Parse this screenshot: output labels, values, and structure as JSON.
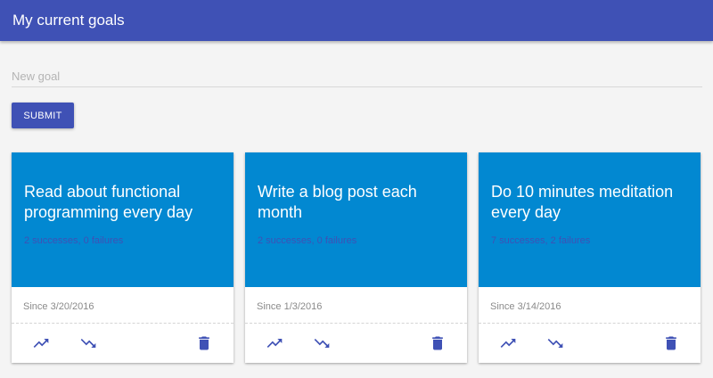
{
  "header": {
    "title": "My current goals"
  },
  "form": {
    "placeholder": "New goal",
    "value": "",
    "submit_label": "SUBMIT"
  },
  "colors": {
    "primary": "#3f51b5",
    "card_media": "#0288d1"
  },
  "cards": [
    {
      "title": "Read about functional programming every day",
      "stats": "2 successes, 0 failures",
      "since": "Since 3/20/2016",
      "actions": [
        "trending-up-icon",
        "trending-down-icon",
        "trash-icon"
      ]
    },
    {
      "title": "Write a blog post each month",
      "stats": "2 successes, 0 failures",
      "since": "Since 1/3/2016",
      "actions": [
        "trending-up-icon",
        "trending-down-icon",
        "trash-icon"
      ]
    },
    {
      "title": "Do 10 minutes meditation every day",
      "stats": "7 successes, 2 failures",
      "since": "Since 3/14/2016",
      "actions": [
        "trending-up-icon",
        "trending-down-icon",
        "trash-icon"
      ]
    }
  ]
}
